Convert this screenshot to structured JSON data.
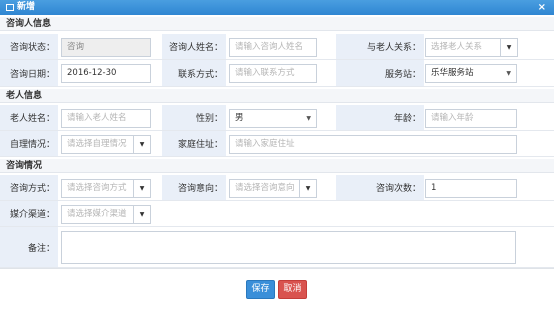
{
  "dialog": {
    "title": "新增",
    "close_symbol": "×"
  },
  "sections": {
    "consultant": "咨询人信息",
    "elder": "老人信息",
    "consultation": "咨询情况"
  },
  "consultant": {
    "status_label": "咨询状态：",
    "status_value": "咨询",
    "name_label": "咨询人姓名：",
    "name_placeholder": "请输入咨询人姓名",
    "relation_label": "与老人关系：",
    "relation_placeholder": "选择老人关系",
    "date_label": "咨询日期：",
    "date_value": "2016-12-30",
    "contact_label": "联系方式：",
    "contact_placeholder": "请输入联系方式",
    "station_label": "服务站：",
    "station_value": "乐华服务站"
  },
  "elder": {
    "name_label": "老人姓名：",
    "name_placeholder": "请输入老人姓名",
    "gender_label": "性别：",
    "gender_value": "男",
    "age_label": "年龄：",
    "age_placeholder": "请输入年龄",
    "selfcare_label": "自理情况：",
    "selfcare_placeholder": "请选择自理情况",
    "address_label": "家庭住址：",
    "address_placeholder": "请输入家庭住址"
  },
  "consultation": {
    "method_label": "咨询方式：",
    "method_placeholder": "请选择咨询方式",
    "intent_label": "咨询意向：",
    "intent_placeholder": "请选择咨询意向",
    "count_label": "咨询次数：",
    "count_value": "1",
    "channel_label": "媒介渠道：",
    "channel_placeholder": "请选择媒介渠道",
    "remark_label": "备注："
  },
  "buttons": {
    "save": "保存",
    "cancel": "取消"
  },
  "colors": {
    "title_bar": "#2f86d2",
    "label_bg": "#e9eff8",
    "save": "#3a8fd9",
    "cancel": "#d9534f"
  }
}
